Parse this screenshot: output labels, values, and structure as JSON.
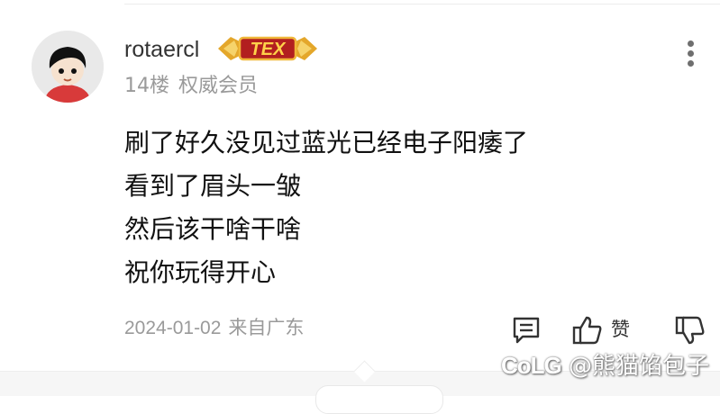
{
  "comment": {
    "username": "rotaercl",
    "badge_text": "TEX",
    "floor": "14楼",
    "member_title": "权威会员",
    "content_lines": [
      "刷了好久没见过蓝光已经电子阳痿了",
      "看到了眉头一皱",
      "然后该干啥干啥",
      "祝你玩得开心"
    ],
    "date": "2024-01-02",
    "location": "来自广东",
    "like_label": "赞"
  },
  "watermark": {
    "logo": "CoLG",
    "handle": "@熊猫馅包子"
  },
  "icons": {
    "more": "more-vertical-icon",
    "reply": "reply-icon",
    "like": "thumbs-up-icon",
    "dislike": "thumbs-down-icon"
  }
}
